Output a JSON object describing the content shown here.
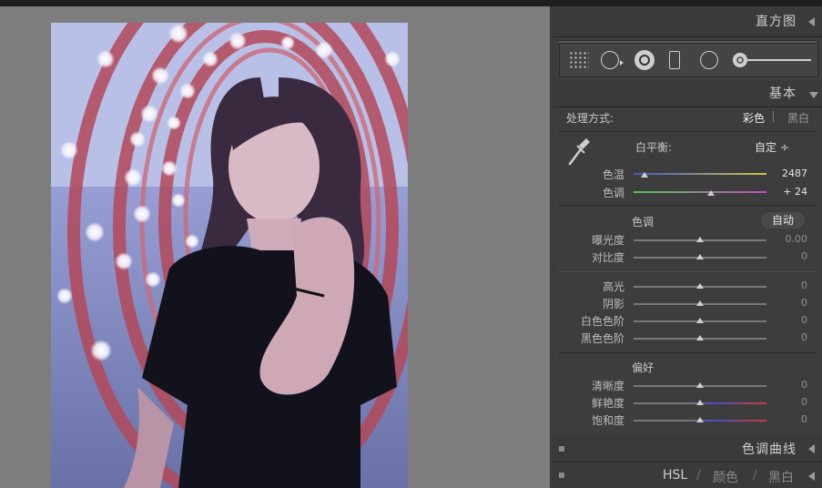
{
  "panels": {
    "histogram": "直方图",
    "basic": "基本",
    "tone_curve": "色调曲线",
    "hsl_tabs": {
      "hsl": "HSL",
      "color": "颜色",
      "bw": "黑白",
      "slash": "/"
    }
  },
  "treatment": {
    "label": "处理方式:",
    "color": "彩色",
    "bw": "黑白"
  },
  "white_balance": {
    "label": "白平衡:",
    "value": "自定 ÷"
  },
  "temp": {
    "label": "色温",
    "value": "2487",
    "position": 0.08
  },
  "tint": {
    "label": "色调",
    "value": "+ 24",
    "position": 0.58
  },
  "tone": {
    "label": "色调",
    "auto": "自动"
  },
  "exposure": {
    "label": "曝光度",
    "value": "0.00",
    "position": 0.5
  },
  "contrast": {
    "label": "对比度",
    "value": "0",
    "position": 0.5
  },
  "highlights": {
    "label": "高光",
    "value": "0",
    "position": 0.5
  },
  "shadows": {
    "label": "阴影",
    "value": "0",
    "position": 0.5
  },
  "whites": {
    "label": "白色色阶",
    "value": "0",
    "position": 0.5
  },
  "blacks": {
    "label": "黑色色阶",
    "value": "0",
    "position": 0.5
  },
  "presence": {
    "label": "偏好"
  },
  "clarity": {
    "label": "清晰度",
    "value": "0",
    "position": 0.5
  },
  "vibrance": {
    "label": "鲜艳度",
    "value": "0",
    "position": 0.5
  },
  "saturation": {
    "label": "饱和度",
    "value": "0",
    "position": 0.5
  },
  "colors": {
    "panel_bg": "#3d3d3d",
    "canvas_bg": "#7d7d7d",
    "temp_gradient": [
      "#4b54c8",
      "#c8c84b"
    ],
    "tint_gradient": [
      "#4bc84b",
      "#c84bc8"
    ],
    "vibrance_gradient": [
      "#4b4bc8",
      "#c83c3c"
    ]
  }
}
